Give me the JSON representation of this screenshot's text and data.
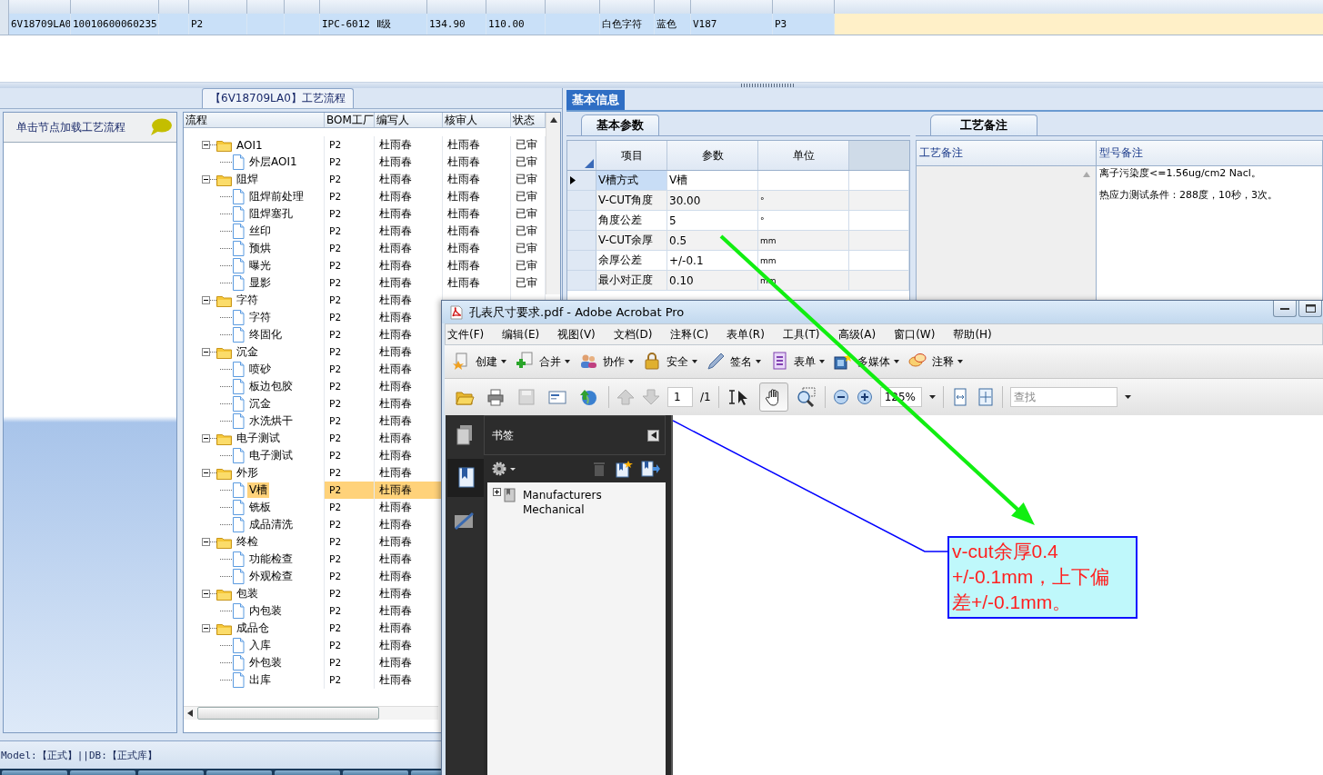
{
  "top_grid": {
    "cells": [
      {
        "text": "6V18709LA0"
      },
      {
        "text": "10010600060235"
      },
      {},
      {
        "text": "P2"
      },
      {},
      {},
      {
        "text": "IPC-6012 Ⅱ级"
      },
      {
        "text": "134.90"
      },
      {
        "text": "110.00"
      },
      {},
      {
        "text": "白色字符"
      },
      {
        "text": "蓝色"
      },
      {
        "text": "V187"
      },
      {
        "text": "P3"
      }
    ]
  },
  "left_section": {
    "title": "【6V18709LA0】工艺流程",
    "hint": "单击节点加载工艺流程"
  },
  "tree": {
    "columns": [
      "流程",
      "BOM工厂",
      "编写人",
      "核审人",
      "状态"
    ],
    "nodes": [
      {
        "label": "AOI1",
        "bom": "P2",
        "writer": "杜雨春",
        "reviewer": "杜雨春",
        "status": "已审",
        "expanded": true,
        "selected": false,
        "children": [
          {
            "label": "外层AOI1",
            "bom": "P2",
            "writer": "杜雨春",
            "reviewer": "杜雨春",
            "status": "已审",
            "selected": false
          }
        ]
      },
      {
        "label": "阻焊",
        "bom": "P2",
        "writer": "杜雨春",
        "reviewer": "杜雨春",
        "status": "已审",
        "expanded": true,
        "selected": false,
        "children": [
          {
            "label": "阻焊前处理",
            "bom": "P2",
            "writer": "杜雨春",
            "reviewer": "杜雨春",
            "status": "已审",
            "selected": false
          },
          {
            "label": "阻焊塞孔",
            "bom": "P2",
            "writer": "杜雨春",
            "reviewer": "杜雨春",
            "status": "已审",
            "selected": false
          },
          {
            "label": "丝印",
            "bom": "P2",
            "writer": "杜雨春",
            "reviewer": "杜雨春",
            "status": "已审",
            "selected": false
          },
          {
            "label": "预烘",
            "bom": "P2",
            "writer": "杜雨春",
            "reviewer": "杜雨春",
            "status": "已审",
            "selected": false
          },
          {
            "label": "曝光",
            "bom": "P2",
            "writer": "杜雨春",
            "reviewer": "杜雨春",
            "status": "已审",
            "selected": false
          },
          {
            "label": "显影",
            "bom": "P2",
            "writer": "杜雨春",
            "reviewer": "杜雨春",
            "status": "已审",
            "selected": false
          }
        ]
      },
      {
        "label": "字符",
        "bom": "P2",
        "writer": "杜雨春",
        "expanded": true,
        "selected": false,
        "children": [
          {
            "label": "字符",
            "bom": "P2",
            "writer": "杜雨春",
            "selected": false
          },
          {
            "label": "终固化",
            "bom": "P2",
            "writer": "杜雨春",
            "selected": false
          }
        ]
      },
      {
        "label": "沉金",
        "bom": "P2",
        "writer": "杜雨春",
        "expanded": true,
        "selected": false,
        "children": [
          {
            "label": "喷砂",
            "bom": "P2",
            "writer": "杜雨春",
            "selected": false
          },
          {
            "label": "板边包胶",
            "bom": "P2",
            "writer": "杜雨春",
            "selected": false
          },
          {
            "label": "沉金",
            "bom": "P2",
            "writer": "杜雨春",
            "selected": false
          },
          {
            "label": "水洗烘干",
            "bom": "P2",
            "writer": "杜雨春",
            "selected": false
          }
        ]
      },
      {
        "label": "电子测试",
        "bom": "P2",
        "writer": "杜雨春",
        "expanded": true,
        "selected": false,
        "children": [
          {
            "label": "电子测试",
            "bom": "P2",
            "writer": "杜雨春",
            "selected": false
          }
        ]
      },
      {
        "label": "外形",
        "bom": "P2",
        "writer": "杜雨春",
        "expanded": true,
        "selected": false,
        "children": [
          {
            "label": "V槽",
            "bom": "P2",
            "writer": "杜雨春",
            "selected": true
          },
          {
            "label": "铣板",
            "bom": "P2",
            "writer": "杜雨春",
            "selected": false
          },
          {
            "label": "成品清洗",
            "bom": "P2",
            "writer": "杜雨春",
            "selected": false
          }
        ]
      },
      {
        "label": "终检",
        "bom": "P2",
        "writer": "杜雨春",
        "expanded": true,
        "selected": false,
        "children": [
          {
            "label": "功能检查",
            "bom": "P2",
            "writer": "杜雨春",
            "selected": false
          },
          {
            "label": "外观检查",
            "bom": "P2",
            "writer": "杜雨春",
            "selected": false
          }
        ]
      },
      {
        "label": "包装",
        "bom": "P2",
        "writer": "杜雨春",
        "expanded": true,
        "selected": false,
        "children": [
          {
            "label": "内包装",
            "bom": "P2",
            "writer": "杜雨春",
            "selected": false
          }
        ]
      },
      {
        "label": "成品仓",
        "bom": "P2",
        "writer": "杜雨春",
        "expanded": true,
        "selected": false,
        "children": [
          {
            "label": "入库",
            "bom": "P2",
            "writer": "杜雨春",
            "selected": false
          },
          {
            "label": "外包装",
            "bom": "P2",
            "writer": "杜雨春",
            "selected": false
          },
          {
            "label": "出库",
            "bom": "P2",
            "writer": "杜雨春",
            "selected": false
          }
        ]
      }
    ]
  },
  "info_tab": {
    "label": "基本信息",
    "selected": true
  },
  "params": {
    "tab": {
      "label": "基本参数",
      "selected": true
    },
    "columns": [
      "项目",
      "参数",
      "单位"
    ],
    "rows": [
      {
        "item": "V槽方式",
        "value": "V槽",
        "selected": true
      },
      {
        "item": "V-CUT角度",
        "value": "30.00",
        "unit": "°",
        "selected": false
      },
      {
        "item": "角度公差",
        "value": "5",
        "unit": "°",
        "selected": false
      },
      {
        "item": "V-CUT余厚",
        "value": "0.5",
        "unit": "mm",
        "selected": false
      },
      {
        "item": "余厚公差",
        "value": "+/-0.1",
        "unit": "mm",
        "selected": false
      },
      {
        "item": "最小对正度",
        "value": "0.10",
        "unit": "mm",
        "selected": false
      }
    ]
  },
  "remarks": {
    "tab": {
      "label": "工艺备注",
      "selected": true
    },
    "columns": [
      "工艺备注",
      "型号备注"
    ],
    "model_notes": [
      "离子污染度<=1.56ug/cm2 Nacl。",
      "热应力测试条件：288度，10秒，3次。"
    ]
  },
  "status_bar": "Model:【正式】||DB:【正式库】",
  "acrobat": {
    "title": "孔表尺寸要求.pdf - Adobe Acrobat Pro",
    "menu": [
      "文件(F)",
      "编辑(E)",
      "视图(V)",
      "文档(D)",
      "注释(C)",
      "表单(R)",
      "工具(T)",
      "高级(A)",
      "窗口(W)",
      "帮助(H)"
    ],
    "tasks": [
      "创建",
      "合并",
      "协作",
      "安全",
      "签名",
      "表单",
      "多媒体",
      "注释"
    ],
    "page": "1",
    "page_count": "/1",
    "zoom": "125%",
    "search_placeholder": "查找",
    "panel_title": "书签",
    "bookmarks": [
      {
        "label": "Manufacturers Mechanical",
        "expanded": false
      }
    ],
    "callout": [
      "v-cut余厚0.4",
      "+/-0.1mm，上下偏",
      "差+/-0.1mm。"
    ]
  }
}
